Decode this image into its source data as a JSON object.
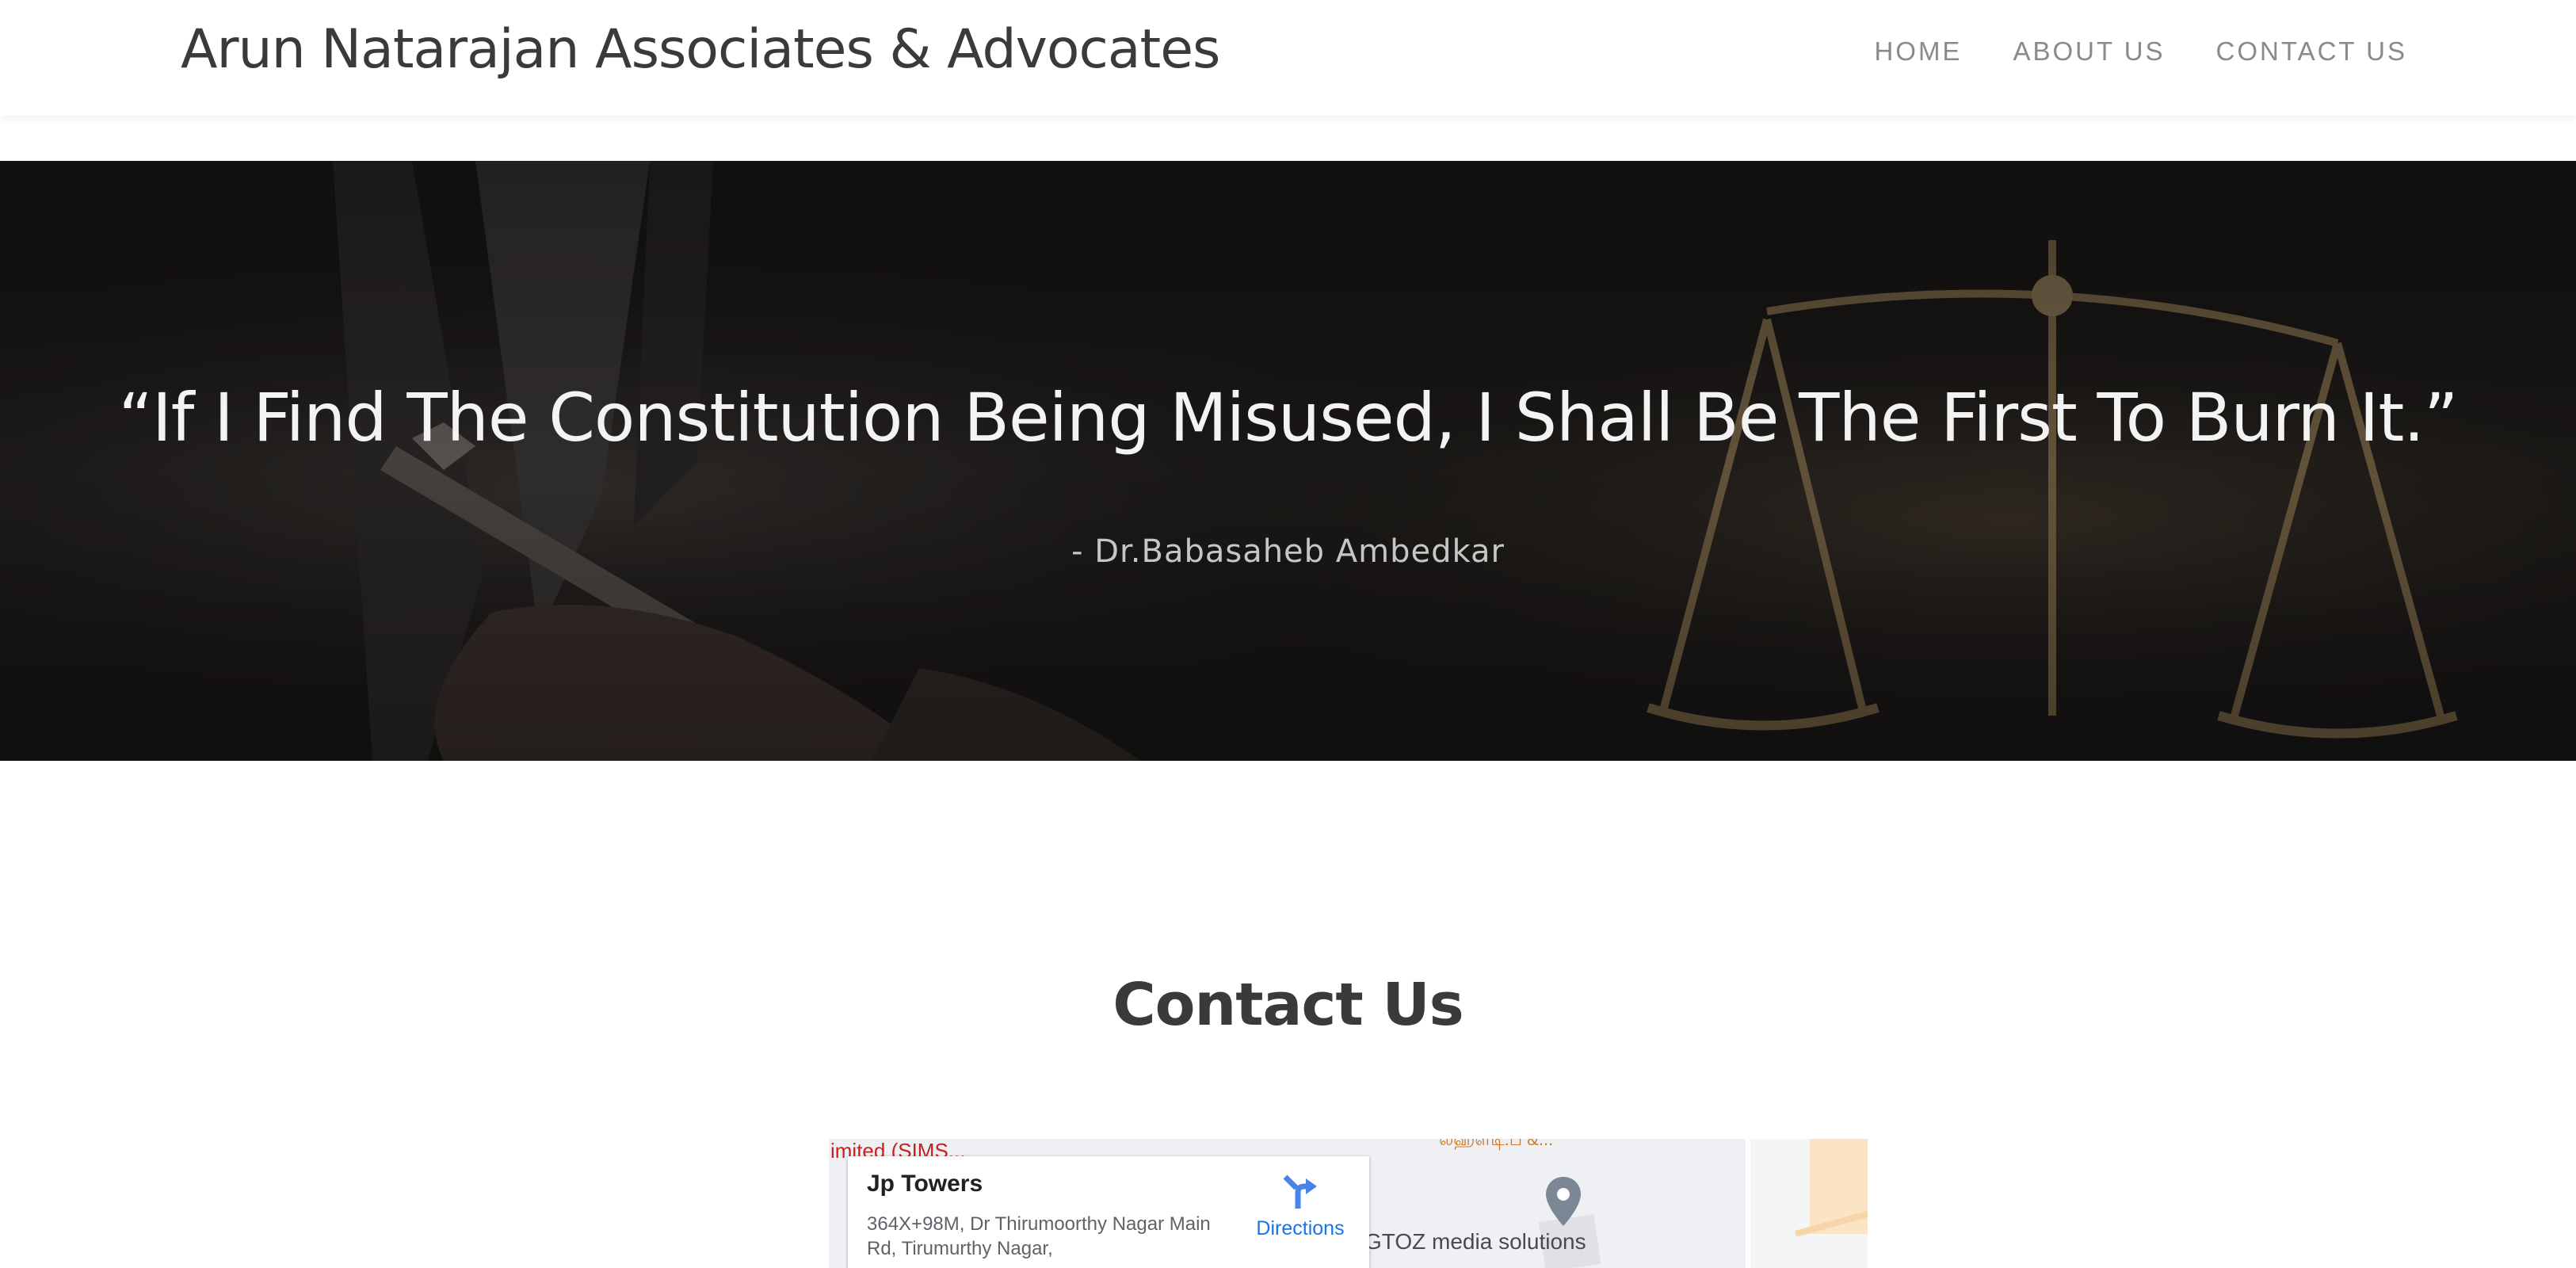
{
  "header": {
    "brand": "Arun Natarajan Associates & Advocates",
    "nav": [
      {
        "label": "HOME"
      },
      {
        "label": "ABOUT US"
      },
      {
        "label": "CONTACT US"
      }
    ]
  },
  "hero": {
    "quote": "“If I Find The Constitution Being Misused, I Shall Be The First To Burn It.”",
    "author": "- Dr.Babasaheb Ambedkar",
    "background_icons": [
      "hand-with-pen",
      "scales-of-justice"
    ]
  },
  "contact": {
    "title": "Contact Us"
  },
  "map": {
    "place_name": "Jp Towers",
    "address": "364X+98M, Dr Thirumoorthy Nagar Main Rd, Tirumurthy Nagar,",
    "directions_label": "Directions",
    "labels": {
      "red_poi": "imited (SIMS...",
      "top_poi": "லஹ்ள்டி.ப &...",
      "business_poi": "GTOZ media solutions"
    }
  },
  "colors": {
    "header_bg": "#ffffff",
    "hero_overlay": "#1d1b1a",
    "link_blue": "#1a73e8",
    "map_red": "#c5221f"
  }
}
